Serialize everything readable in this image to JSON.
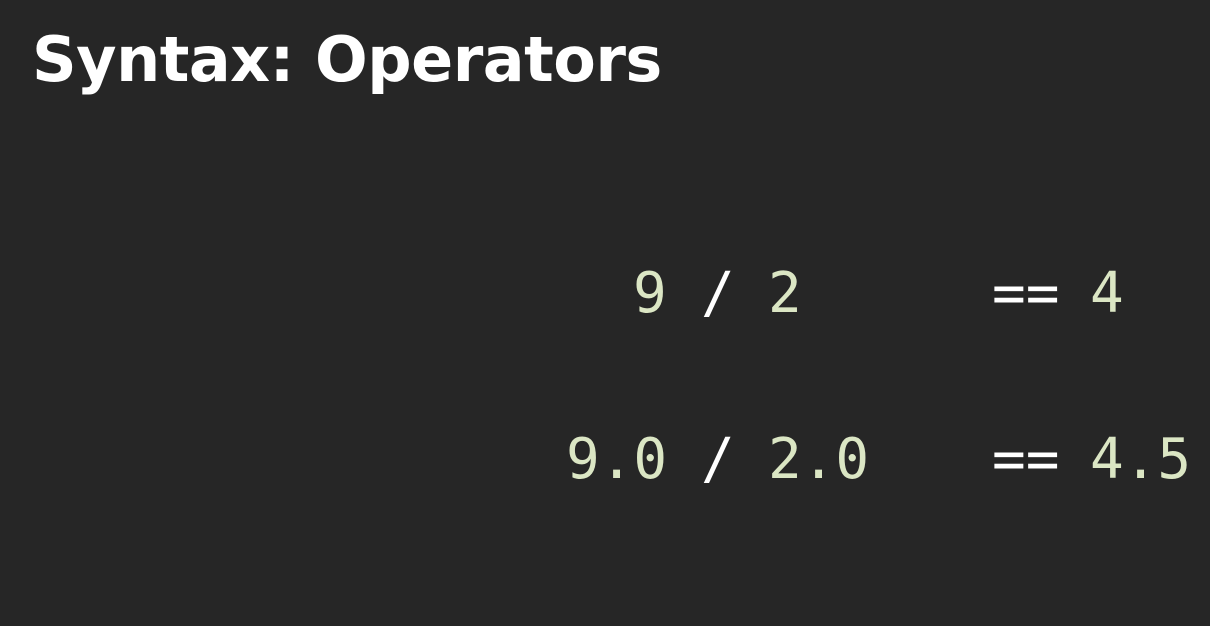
{
  "slide": {
    "title": "Syntax: Operators",
    "rows": [
      {
        "lhs": "9",
        "op": "/",
        "rhs": "2",
        "eq": "==",
        "result": "4"
      },
      {
        "lhs": "9.0",
        "op": "/",
        "rhs": "2.0",
        "eq": "==",
        "result": "4.5"
      }
    ]
  },
  "colors": {
    "background": "#262626",
    "title": "#ffffff",
    "number": "#dbe6c4",
    "operator": "#ffffff"
  }
}
